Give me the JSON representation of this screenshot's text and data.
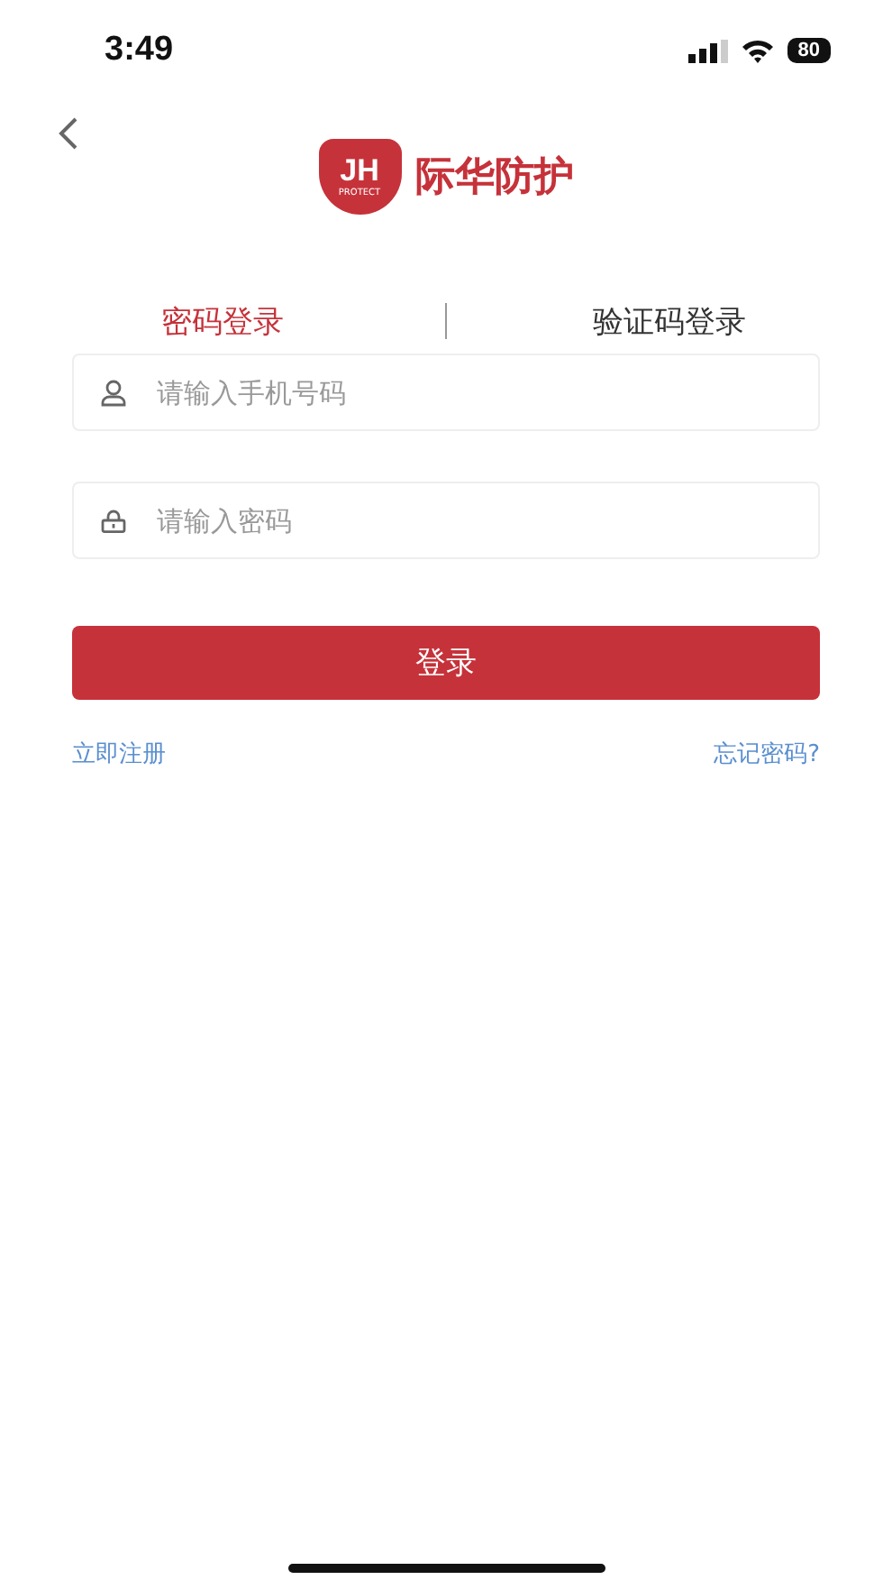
{
  "status_bar": {
    "time": "3:49",
    "battery": "80"
  },
  "logo": {
    "mark": "JH",
    "tagline": "PROTECT",
    "name": "际华防护"
  },
  "tabs": [
    {
      "label": "密码登录",
      "selected": true
    },
    {
      "label": "验证码登录",
      "selected": false
    }
  ],
  "fields": [
    {
      "kind": "phone",
      "placeholder": "请输入手机号码"
    },
    {
      "kind": "password",
      "placeholder": "请输入密码"
    }
  ],
  "login_button": "登录",
  "links": {
    "register": "立即注册",
    "forgot": "忘记密码?"
  }
}
